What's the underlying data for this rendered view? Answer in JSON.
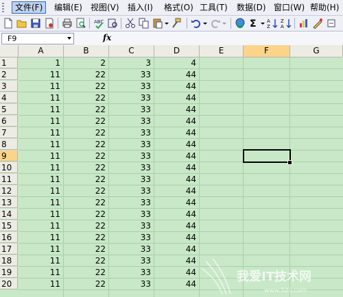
{
  "menu": [
    {
      "label": "文件(F)",
      "active": true
    },
    {
      "label": "编辑(E)"
    },
    {
      "label": "视图(V)"
    },
    {
      "label": "插入(I)"
    },
    {
      "label": "格式(O)"
    },
    {
      "label": "工具(T)"
    },
    {
      "label": "数据(D)"
    },
    {
      "label": "窗口(W)"
    },
    {
      "label": "帮助(H)"
    }
  ],
  "formula_bar": {
    "name_box": "F9",
    "fx": "fx",
    "content": ""
  },
  "columns": [
    "A",
    "B",
    "C",
    "D",
    "E",
    "F",
    "G"
  ],
  "selected_column": "F",
  "selected_row": 9,
  "rows": [
    {
      "n": "1",
      "vals": [
        "1",
        "2",
        "3",
        "4"
      ]
    },
    {
      "n": "2",
      "vals": [
        "11",
        "22",
        "33",
        "44"
      ]
    },
    {
      "n": "3",
      "vals": [
        "11",
        "22",
        "33",
        "44"
      ]
    },
    {
      "n": "4",
      "vals": [
        "11",
        "22",
        "33",
        "44"
      ]
    },
    {
      "n": "5",
      "vals": [
        "11",
        "22",
        "33",
        "44"
      ]
    },
    {
      "n": "6",
      "vals": [
        "11",
        "22",
        "33",
        "44"
      ]
    },
    {
      "n": "7",
      "vals": [
        "11",
        "22",
        "33",
        "44"
      ]
    },
    {
      "n": "8",
      "vals": [
        "11",
        "22",
        "33",
        "44"
      ]
    },
    {
      "n": "9",
      "vals": [
        "11",
        "22",
        "33",
        "44"
      ]
    },
    {
      "n": "10",
      "vals": [
        "11",
        "22",
        "33",
        "44"
      ]
    },
    {
      "n": "11",
      "vals": [
        "11",
        "22",
        "33",
        "44"
      ]
    },
    {
      "n": "12",
      "vals": [
        "11",
        "22",
        "33",
        "44"
      ]
    },
    {
      "n": "13",
      "vals": [
        "11",
        "22",
        "33",
        "44"
      ]
    },
    {
      "n": "14",
      "vals": [
        "11",
        "22",
        "33",
        "44"
      ]
    },
    {
      "n": "15",
      "vals": [
        "11",
        "22",
        "33",
        "44"
      ]
    },
    {
      "n": "16",
      "vals": [
        "11",
        "22",
        "33",
        "44"
      ]
    },
    {
      "n": "17",
      "vals": [
        "11",
        "22",
        "33",
        "44"
      ]
    },
    {
      "n": "18",
      "vals": [
        "11",
        "22",
        "33",
        "44"
      ]
    },
    {
      "n": "19",
      "vals": [
        "11",
        "22",
        "33",
        "44"
      ]
    },
    {
      "n": "20",
      "vals": [
        "11",
        "22",
        "33",
        "44"
      ]
    }
  ],
  "watermark": {
    "text": "我爱IT技术网",
    "url": "www.52ij.com"
  },
  "colors": {
    "sheet_bg": "#c8e8c8",
    "header_bg": "#ecebe4",
    "selected_header": "#fbd48a",
    "menu_bg": "#eef0f6"
  }
}
